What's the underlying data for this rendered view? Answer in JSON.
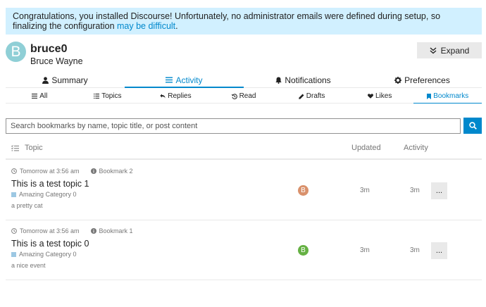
{
  "banner": {
    "text": "Congratulations, you installed Discourse! Unfortunately, no administrator emails were defined during setup, so finalizing the configuration ",
    "link_text": "may be difficult",
    "suffix": "."
  },
  "user": {
    "avatar_letter": "B",
    "username": "bruce0",
    "full_name": "Bruce Wayne",
    "avatar_color": "#8fcfd6"
  },
  "expand_button": {
    "label": "Expand",
    "icon": "double-chevron-down-icon"
  },
  "main_nav": [
    {
      "label": "Summary",
      "icon": "user-icon",
      "active": false
    },
    {
      "label": "Activity",
      "icon": "list-icon",
      "active": true
    },
    {
      "label": "Notifications",
      "icon": "bell-icon",
      "active": false
    },
    {
      "label": "Preferences",
      "icon": "gear-icon",
      "active": false
    }
  ],
  "sub_nav": [
    {
      "label": "All",
      "icon": "list-icon",
      "active": false
    },
    {
      "label": "Topics",
      "icon": "topics-icon",
      "active": false
    },
    {
      "label": "Replies",
      "icon": "reply-icon",
      "active": false
    },
    {
      "label": "Read",
      "icon": "history-icon",
      "active": false
    },
    {
      "label": "Drafts",
      "icon": "pencil-icon",
      "active": false
    },
    {
      "label": "Likes",
      "icon": "heart-icon",
      "active": false
    },
    {
      "label": "Bookmarks",
      "icon": "bookmark-icon",
      "active": true
    }
  ],
  "search": {
    "placeholder": "Search bookmarks by name, topic title, or post content",
    "value": ""
  },
  "table": {
    "headers": {
      "topic": "Topic",
      "updated": "Updated",
      "activity": "Activity"
    },
    "rows": [
      {
        "reminder": "Tomorrow at 3:56 am",
        "bookmark_name": "Bookmark 2",
        "title": "This is a test topic 1",
        "category": "Amazing Category 0",
        "excerpt": "a pretty cat",
        "poster_letter": "B",
        "poster_color": "#d9916c",
        "updated": "3m",
        "activity": "3m",
        "more": "..."
      },
      {
        "reminder": "Tomorrow at 3:56 am",
        "bookmark_name": "Bookmark 1",
        "title": "This is a test topic 0",
        "category": "Amazing Category 0",
        "excerpt": "a nice event",
        "poster_letter": "B",
        "poster_color": "#65b143",
        "updated": "3m",
        "activity": "3m",
        "more": "..."
      }
    ]
  },
  "colors": {
    "accent": "#0088cc",
    "banner_bg": "#d1f0ff",
    "category": "#9dc8e3"
  }
}
